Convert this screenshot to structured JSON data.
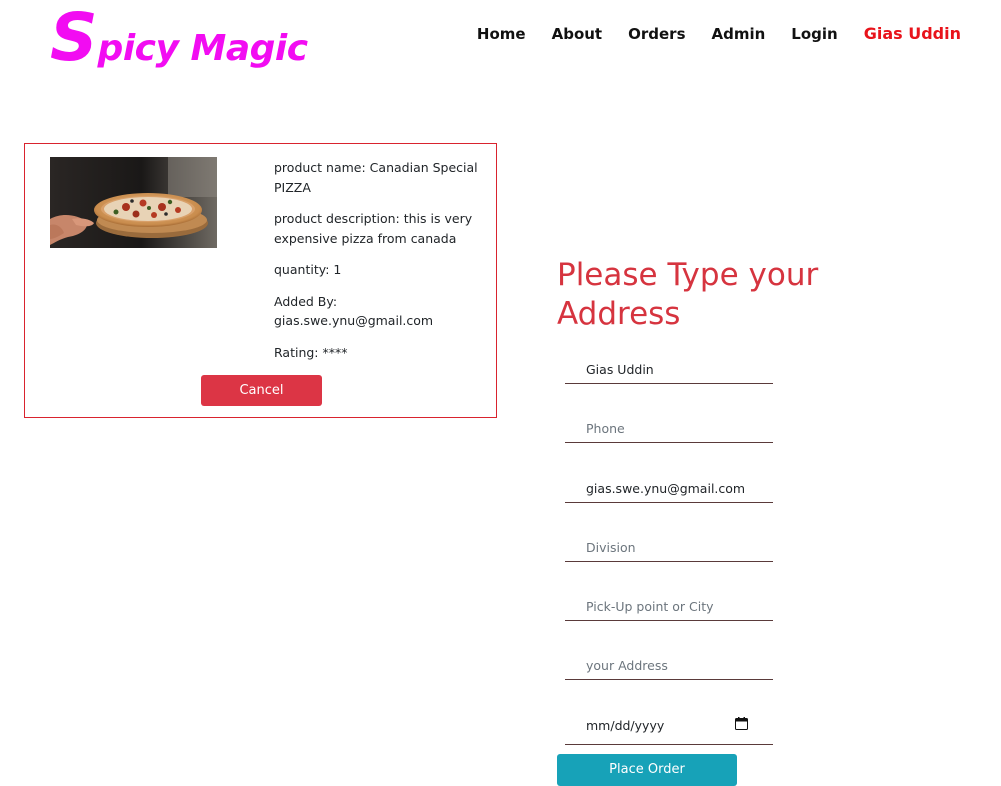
{
  "header": {
    "logo_initial": "S",
    "logo_rest": "picy Magic",
    "nav": [
      {
        "label": "Home"
      },
      {
        "label": "About"
      },
      {
        "label": "Orders"
      },
      {
        "label": "Admin"
      },
      {
        "label": "Login"
      }
    ],
    "user_name": "Gias Uddin"
  },
  "order": {
    "product_name_line": "product name: Canadian Special PIZZA",
    "description_line": "product description: this is very expensive pizza from canada",
    "quantity_line": "quantity: 1",
    "added_by_line": "Added By: gias.swe.ynu@gmail.com",
    "rating_line": "Rating: ****",
    "image_alt": "pizza",
    "cancel_label": "Cancel"
  },
  "address_form": {
    "title": "Please Type your Address",
    "name_value": "Gias Uddin",
    "phone_placeholder": "Phone",
    "email_value": "gias.swe.ynu@gmail.com",
    "division_placeholder": "Division",
    "city_placeholder": "Pick-Up point or City",
    "address_placeholder": "your Address",
    "date_placeholder": "mm/dd/yyyy",
    "submit_label": "Place Order"
  },
  "colors": {
    "brand": "#f20cf2",
    "user_name": "#e8131b",
    "card_border": "#d9232e",
    "cancel_button": "#dc3545",
    "form_title": "#d6343f",
    "submit_button": "#17a2b8"
  },
  "icons": {
    "date_picker": "calendar-icon"
  }
}
